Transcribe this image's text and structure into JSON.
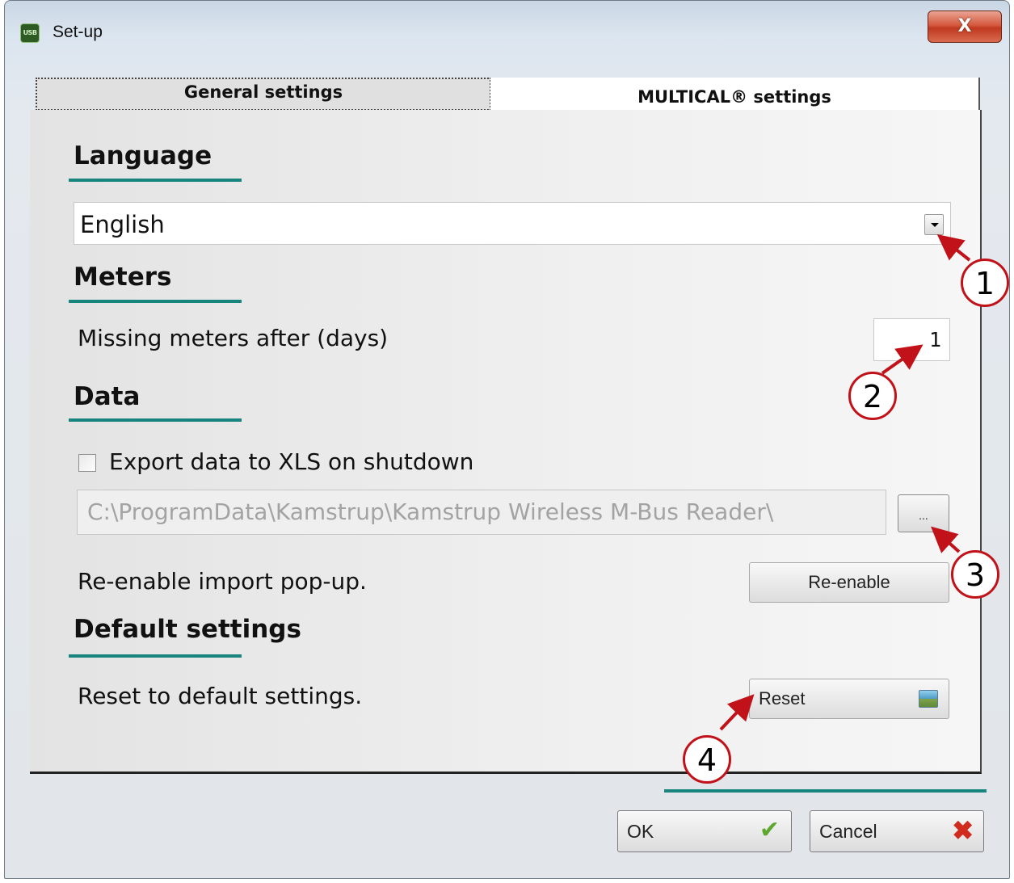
{
  "window": {
    "title": "Set-up",
    "app_icon_text": "USB",
    "close_label": "X"
  },
  "tabs": [
    {
      "label": "General settings",
      "selected": true
    },
    {
      "label": "MULTICAL® settings",
      "selected": false
    }
  ],
  "language": {
    "heading": "Language",
    "selected_value": "English"
  },
  "meters": {
    "heading": "Meters",
    "missing_label": "Missing meters after (days)",
    "missing_value": "1"
  },
  "data": {
    "heading": "Data",
    "export_checkbox_label": "Export data to XLS on shutdown",
    "export_checked": false,
    "export_path": "C:\\ProgramData\\Kamstrup\\Kamstrup Wireless M-Bus Reader\\",
    "browse_label": "...",
    "reenable_label": "Re-enable import pop-up.",
    "reenable_button": "Re-enable"
  },
  "defaults": {
    "heading": "Default settings",
    "reset_label": "Reset to default settings.",
    "reset_button": "Reset"
  },
  "footer": {
    "ok_label": "OK",
    "cancel_label": "Cancel"
  },
  "callouts": [
    "1",
    "2",
    "3",
    "4"
  ],
  "colors": {
    "accent_underline": "#17847d",
    "callout_border": "#c1121a",
    "close_button": "#c94a30"
  }
}
